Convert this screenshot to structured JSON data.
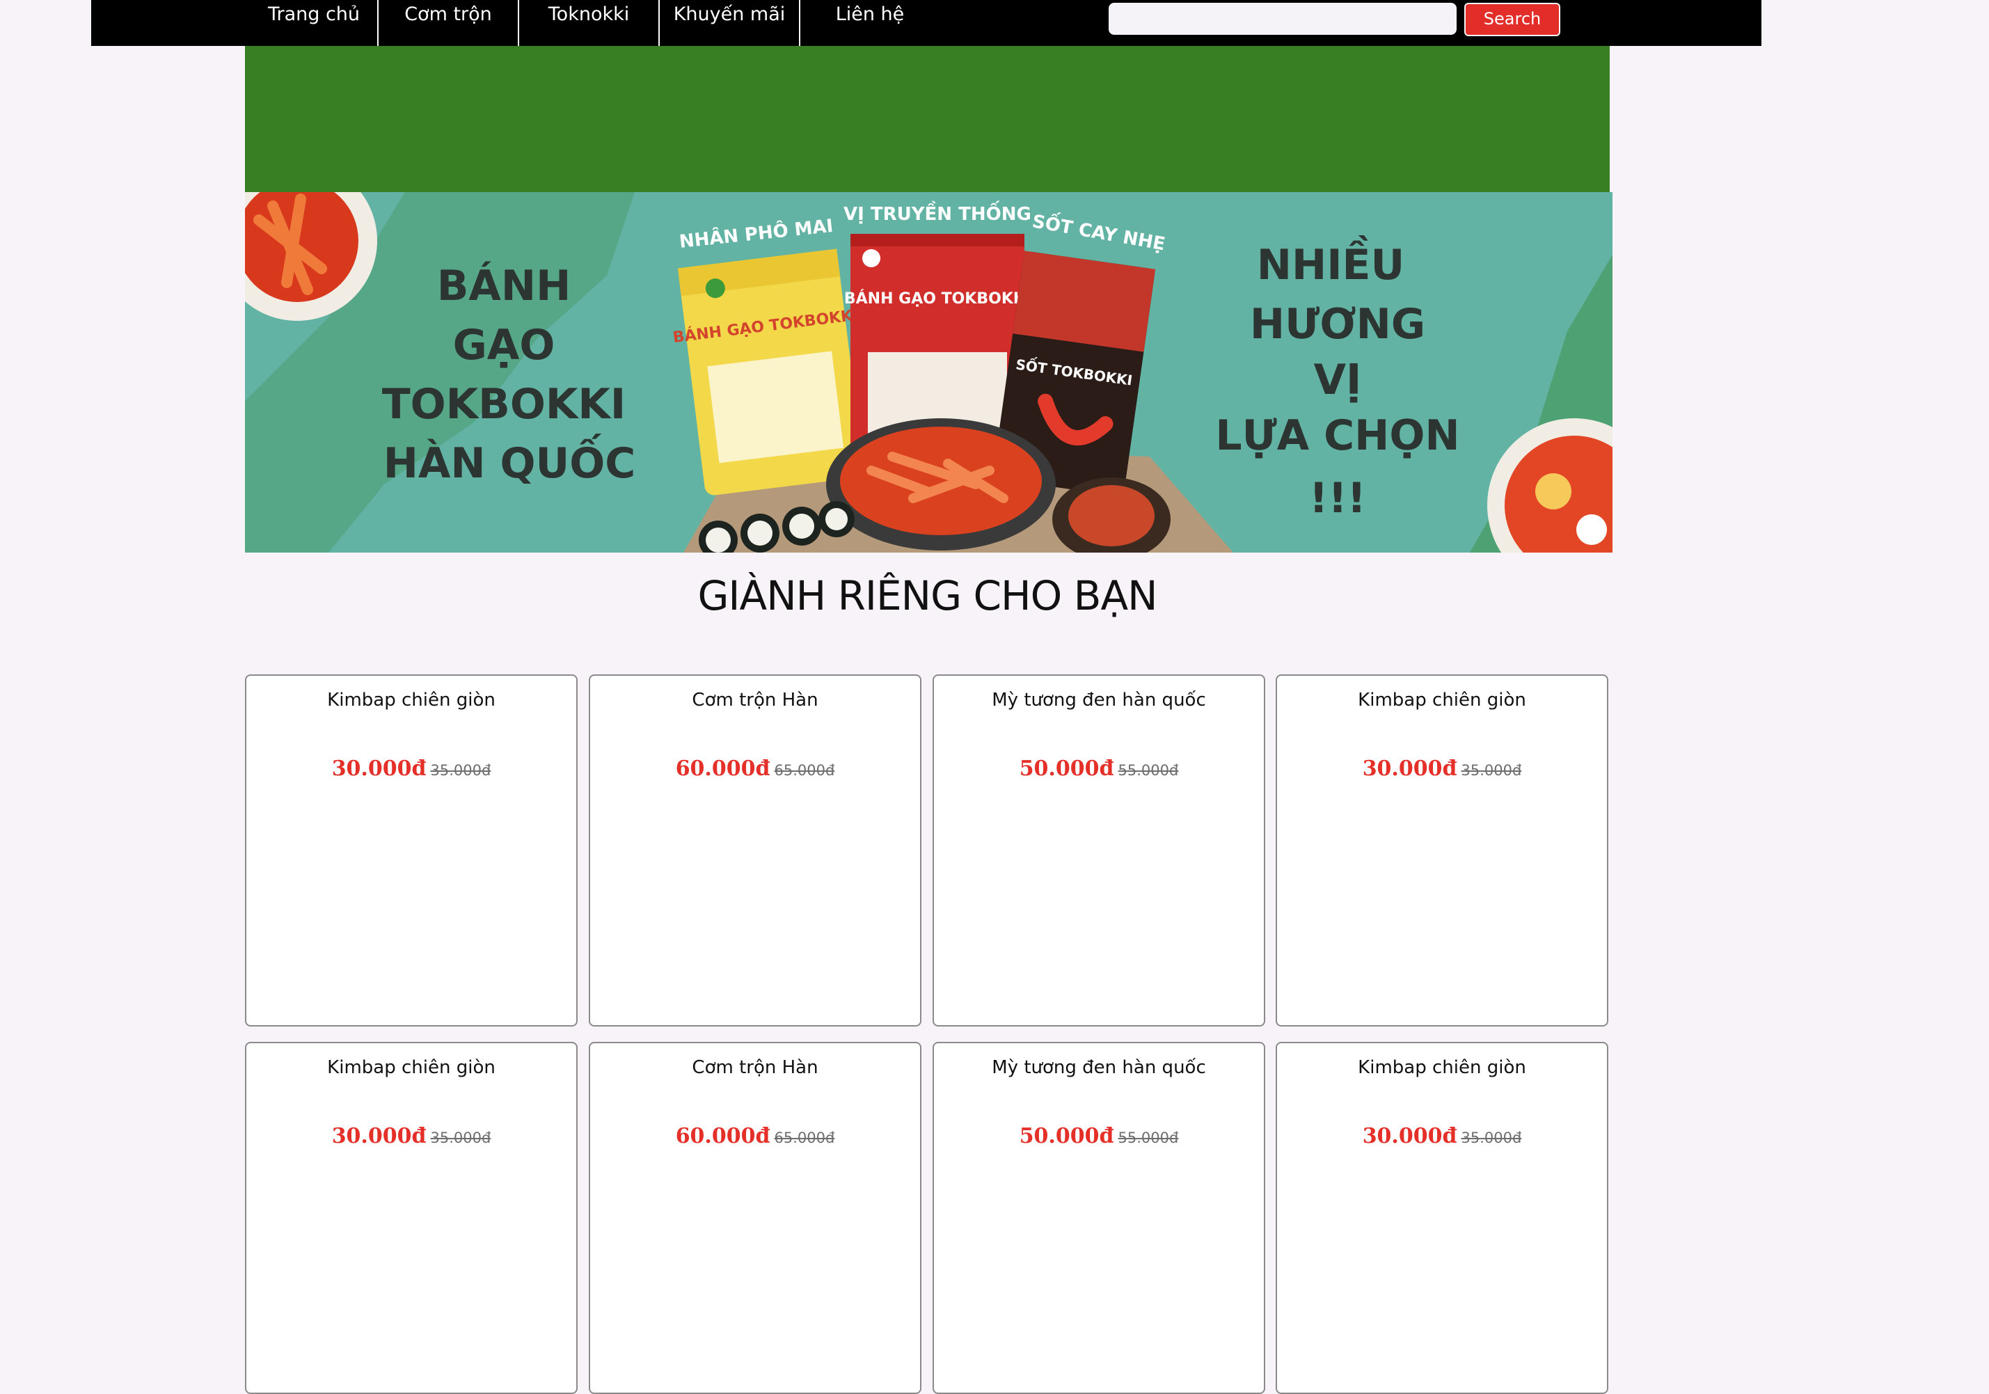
{
  "nav": {
    "items": [
      {
        "label": "Trang chủ"
      },
      {
        "label": "Cơm trộn"
      },
      {
        "label": "Toknokki"
      },
      {
        "label": "Khuyến mãi"
      },
      {
        "label": "Liên hệ"
      }
    ]
  },
  "search": {
    "value": "",
    "placeholder": "",
    "button_label": "Search"
  },
  "banner": {
    "left_text": [
      "BÁNH",
      "GẠO",
      "TOKBOKKI",
      "HÀN QUỐC"
    ],
    "right_text": [
      "NHIỀU",
      "HƯƠNG",
      "VỊ",
      "LỰA CHỌN",
      "!!!"
    ],
    "package_tags": [
      "NHÂN PHÔ MAI",
      "VỊ TRUYỀN THỐNG",
      "SỐT CAY NHẸ"
    ],
    "package_labels": [
      "BÁNH GẠO TOKBOKKI",
      "BÁNH GẠO TOKBOKKI",
      "SỐT TOKBOKKI"
    ]
  },
  "section": {
    "title": "GIÀNH RIÊNG CHO BẠN"
  },
  "products": [
    {
      "name": "Kimbap chiên giòn",
      "price": "30.000đ",
      "old_price": "35.000đ"
    },
    {
      "name": "Cơm trộn Hàn",
      "price": "60.000đ",
      "old_price": "65.000đ"
    },
    {
      "name": "Mỳ tương đen hàn quốc",
      "price": "50.000đ",
      "old_price": "55.000đ"
    },
    {
      "name": "Kimbap chiên giòn",
      "price": "30.000đ",
      "old_price": "35.000đ"
    },
    {
      "name": "Kimbap chiên giòn",
      "price": "30.000đ",
      "old_price": "35.000đ"
    },
    {
      "name": "Cơm trộn Hàn",
      "price": "60.000đ",
      "old_price": "65.000đ"
    },
    {
      "name": "Mỳ tương đen hàn quốc",
      "price": "50.000đ",
      "old_price": "55.000đ"
    },
    {
      "name": "Kimbap chiên giòn",
      "price": "30.000đ",
      "old_price": "35.000đ"
    }
  ],
  "colors": {
    "nav_bg": "#000000",
    "accent_red": "#e22d28",
    "hero_green": "#387f23",
    "banner_teal": "#62b3a3",
    "page_bg": "#f7f3f9"
  }
}
